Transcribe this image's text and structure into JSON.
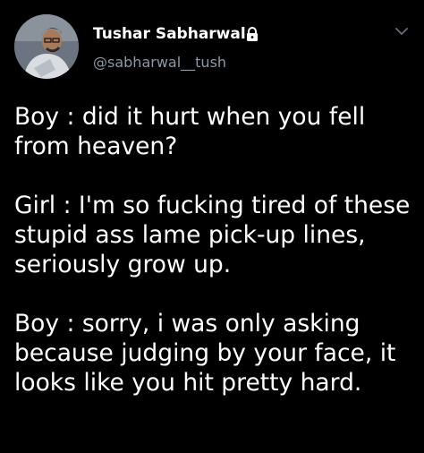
{
  "tweet": {
    "author": {
      "display_name": "Tushar Sabharwal",
      "handle": "@sabharwal__tush",
      "verified_icon": "lock-icon",
      "avatar_icon": "avatar"
    },
    "menu_icon": "chevron-down-icon",
    "paragraphs": [
      "Boy : did it hurt when you fell\nfrom heaven?",
      "Girl : I'm so fucking tired of these\nstupid ass lame pick-up lines,\nseriously grow up.",
      "Boy : sorry, i was only asking\nbecause judging by your face, it\nlooks like you hit pretty hard."
    ]
  },
  "colors": {
    "background": "#000000",
    "text": "#ffffff",
    "secondary_text": "#8b98a5"
  }
}
